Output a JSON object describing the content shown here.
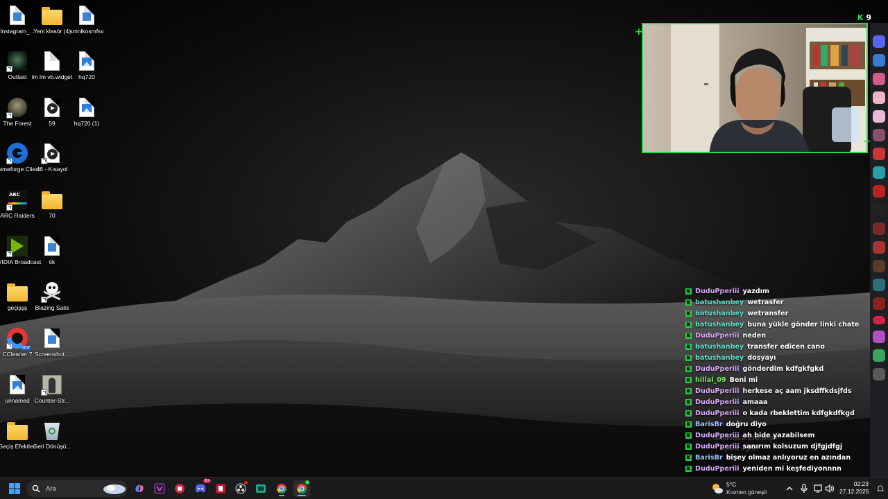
{
  "desktop": {
    "icons": [
      {
        "label": "Instagram_...",
        "icon": "document-file-icon"
      },
      {
        "label": "Yeni klasör (4)",
        "icon": "folder-icon"
      },
      {
        "label": "smnlkosmfsv",
        "icon": "document-file-icon"
      },
      {
        "label": "Outlast",
        "icon": "outlast-game-icon"
      },
      {
        "label": "lm lm vb.widget",
        "icon": "blank-file-icon"
      },
      {
        "label": "hq720",
        "icon": "image-file-icon"
      },
      {
        "label": "The Forest",
        "icon": "the-forest-game-icon"
      },
      {
        "label": "59",
        "icon": "video-file-icon"
      },
      {
        "label": "hq720 (1)",
        "icon": "image-file-icon"
      },
      {
        "label": "Gameforge Client",
        "icon": "gameforge-icon"
      },
      {
        "label": "46 - Kısayol",
        "icon": "video-file-icon"
      },
      {
        "label": "ARC Raiders",
        "icon": "arc-raiders-icon"
      },
      {
        "label": "70",
        "icon": "folder-icon"
      },
      {
        "label": "NVIDIA Broadcast",
        "icon": "nvidia-broadcast-icon"
      },
      {
        "label": "tik",
        "icon": "document-file-icon"
      },
      {
        "label": "geçişşş",
        "icon": "folder-icon"
      },
      {
        "label": "Blazing Sails",
        "icon": "skull-icon"
      },
      {
        "label": "CCleaner 7",
        "icon": "ccleaner-icon"
      },
      {
        "label": "Screenshot...",
        "icon": "document-file-icon"
      },
      {
        "label": "unnamed",
        "icon": "image-file-icon"
      },
      {
        "label": "Counter-Str...",
        "icon": "counter-strike-icon"
      },
      {
        "label": "Geçiş Efektleri",
        "icon": "folder-icon"
      },
      {
        "label": "Geri Dönüşü...",
        "icon": "recycle-bin-icon"
      }
    ]
  },
  "stream_overlay": {
    "badge_count": "9",
    "chat": [
      {
        "user": "DuduPperiii",
        "color": "#d9a8ff",
        "message": "yazdım"
      },
      {
        "user": "batushanbey",
        "color": "#5fe0c8",
        "message": "wetrasfer"
      },
      {
        "user": "batushanbey",
        "color": "#5fe0c8",
        "message": "wetransfer"
      },
      {
        "user": "batushanbey",
        "color": "#5fe0c8",
        "message": "buna yükle gönder linki chate"
      },
      {
        "user": "DuduPperiii",
        "color": "#d9a8ff",
        "message": "neden"
      },
      {
        "user": "batushanbey",
        "color": "#5fe0c8",
        "message": "transfer edicen cano"
      },
      {
        "user": "batushanbey",
        "color": "#5fe0c8",
        "message": "dosyayı"
      },
      {
        "user": "DuduPperiii",
        "color": "#d9a8ff",
        "message": "gönderdim kdfgkfgkd"
      },
      {
        "user": "hillal_09",
        "color": "#7ee86e",
        "message": "Beni mi"
      },
      {
        "user": "DuduPperiii",
        "color": "#d9a8ff",
        "message": "herkese aç aam jksdffkdsjfds"
      },
      {
        "user": "DuduPperiii",
        "color": "#d9a8ff",
        "message": "amaaa"
      },
      {
        "user": "DuduPperiii",
        "color": "#d9a8ff",
        "message": "o kada rbeklettim kdfgkdfkgd"
      },
      {
        "user": "BarisBr",
        "color": "#9ec3ff",
        "message": "doğru diyo"
      },
      {
        "user": "DuduPperiii",
        "color": "#d9a8ff",
        "message": "ah bide yazabilsem"
      },
      {
        "user": "DuduPperiii",
        "color": "#d9a8ff",
        "message": "sanırım kolsuzum djfgjdfgj"
      },
      {
        "user": "BarisBr",
        "color": "#9ec3ff",
        "message": "bişey olmaz anlıyoruz en azından"
      },
      {
        "user": "DuduPperiii",
        "color": "#d9a8ff",
        "message": "yeniden mi keşfediyonnnn"
      }
    ],
    "watermark_line1": "Windows'u Etkinleştir",
    "watermark_line2": "ayarlar'a gidin."
  },
  "taskbar": {
    "search_placeholder": "Ara",
    "weather_temp": "5°C",
    "weather_desc": "Kısmen güneşli",
    "time": "02:23",
    "date": "27.12.2025",
    "apps": [
      {
        "name": "copilot-icon"
      },
      {
        "name": "visual-studio-icon"
      },
      {
        "name": "app-red-icon"
      },
      {
        "name": "discord-icon",
        "badge": "9+"
      },
      {
        "name": "app-red-2-icon"
      },
      {
        "name": "obs-icon"
      },
      {
        "name": "app-green-icon"
      },
      {
        "name": "chrome-icon"
      },
      {
        "name": "chrome-profile-icon"
      }
    ]
  }
}
